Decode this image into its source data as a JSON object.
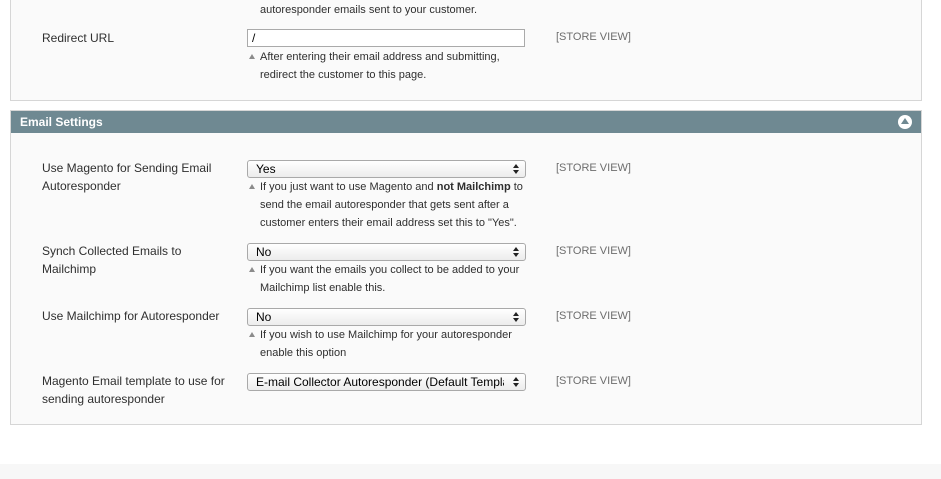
{
  "top_section": {
    "prev_note_tail": "autoresponder emails sent to your customer.",
    "redirect_url": {
      "label": "Redirect URL",
      "value": "/",
      "note": "After entering their email address and submitting, redirect the customer to this page.",
      "scope": "[STORE VIEW]"
    }
  },
  "email_settings": {
    "title": "Email Settings",
    "collapse_icon": "collapse-up-icon",
    "fields": [
      {
        "label": "Use Magento for Sending Email Autoresponder",
        "value": "Yes",
        "note_pre": "If you just want to use Magento and ",
        "note_bold": "not Mailchimp",
        "note_post": " to send the email autoresponder that gets sent after a customer enters their email address set this to \"Yes\".",
        "scope": "[STORE VIEW]"
      },
      {
        "label": "Synch Collected Emails to Mailchimp",
        "value": "No",
        "note": "If you want the emails you collect to be added to your Mailchimp list enable this.",
        "scope": "[STORE VIEW]"
      },
      {
        "label": "Use Mailchimp for Autoresponder",
        "value": "No",
        "note": "If you wish to use Mailchimp for your autoresponder enable this option",
        "scope": "[STORE VIEW]"
      },
      {
        "label": "Magento Email template to use for sending autoresponder",
        "value": "E-mail Collector Autoresponder (Default Template)",
        "scope": "[STORE VIEW]"
      }
    ]
  },
  "colors": {
    "section_header_bg": "#6f8992",
    "fieldset_bg": "#fafafa",
    "scope_text": "#6d6d6d"
  }
}
